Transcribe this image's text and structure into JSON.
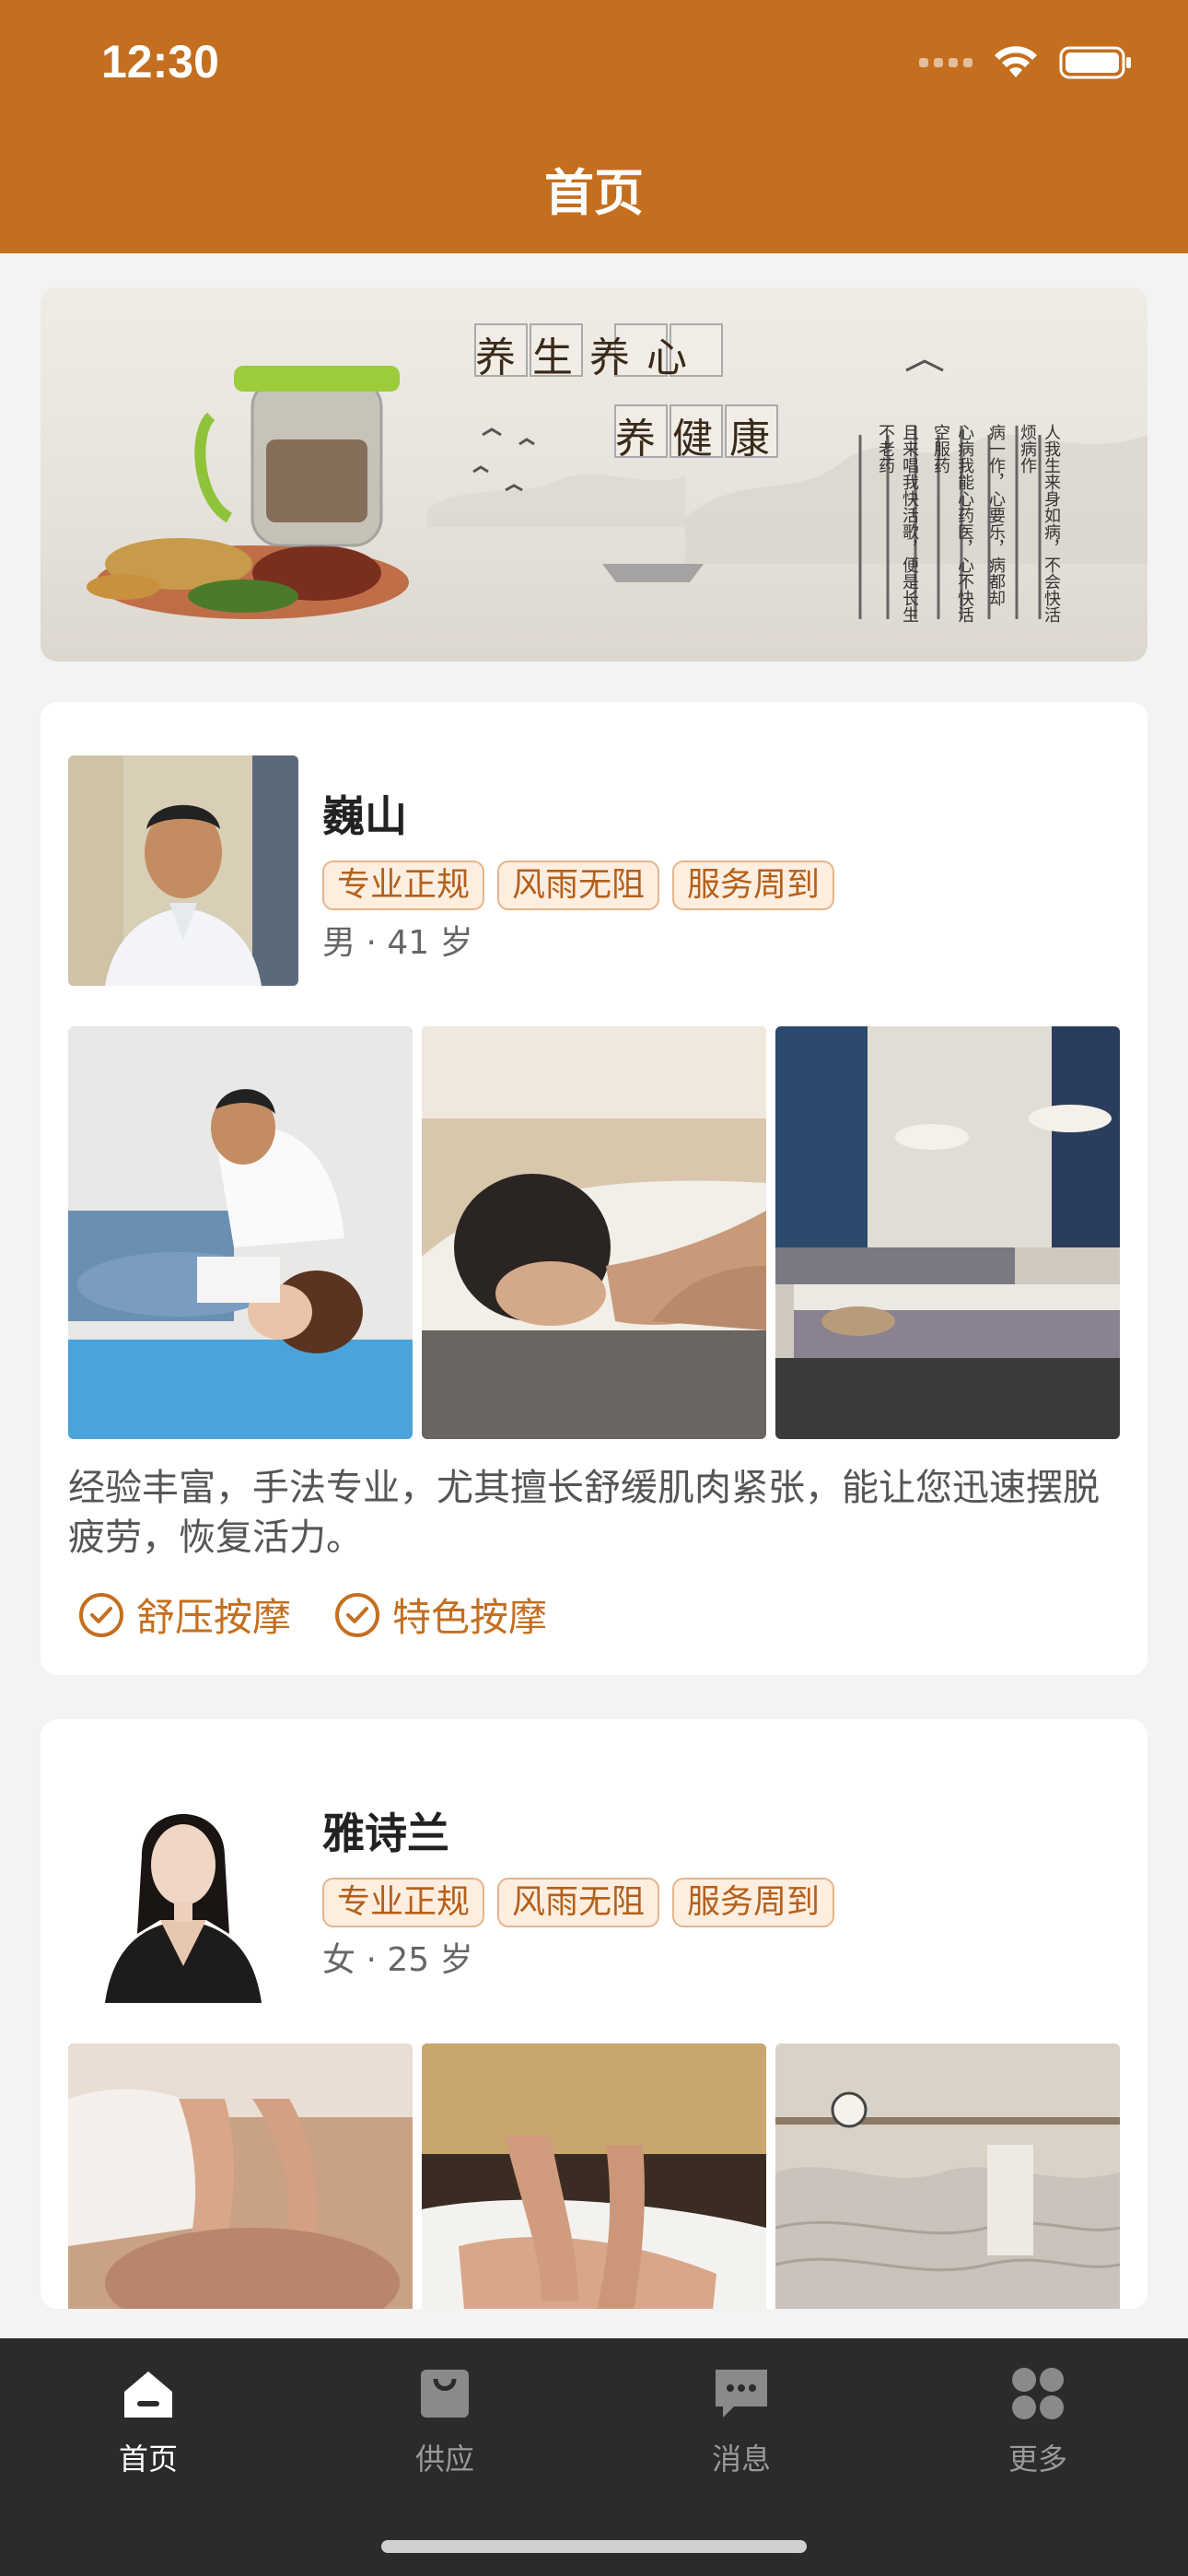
{
  "status": {
    "time": "12:30"
  },
  "header": {
    "title": "首页"
  },
  "banner": {
    "headline1": "养生养心",
    "headline2": "养健康",
    "poem": [
      "人我生来身如病，不会快活烦病作",
      "病一作，心要乐，病都却",
      "心病我能心药医，心不快活空服药",
      "且来唱我快活歌，便是长生不老药"
    ]
  },
  "therapists": [
    {
      "name": "巍山",
      "tags": [
        "专业正规",
        "风雨无阻",
        "服务周到"
      ],
      "meta": "男 · 41 岁",
      "description": "经验丰富，手法专业，尤其擅长舒缓肌肉紧张，能让您迅速摆脱疲劳，恢复活力。",
      "services": [
        "舒压按摩",
        "特色按摩"
      ]
    },
    {
      "name": "雅诗兰",
      "tags": [
        "专业正规",
        "风雨无阻",
        "服务周到"
      ],
      "meta": "女 · 25 岁"
    }
  ],
  "tabbar": {
    "items": [
      {
        "label": "首页",
        "icon": "home-icon",
        "active": true
      },
      {
        "label": "供应",
        "icon": "bag-icon",
        "active": false
      },
      {
        "label": "消息",
        "icon": "message-icon",
        "active": false
      },
      {
        "label": "更多",
        "icon": "grid-icon",
        "active": false
      }
    ]
  },
  "colors": {
    "primary": "#c46f1f",
    "tabbar": "#2b2b2b",
    "tag_bg": "#fdeee0"
  }
}
